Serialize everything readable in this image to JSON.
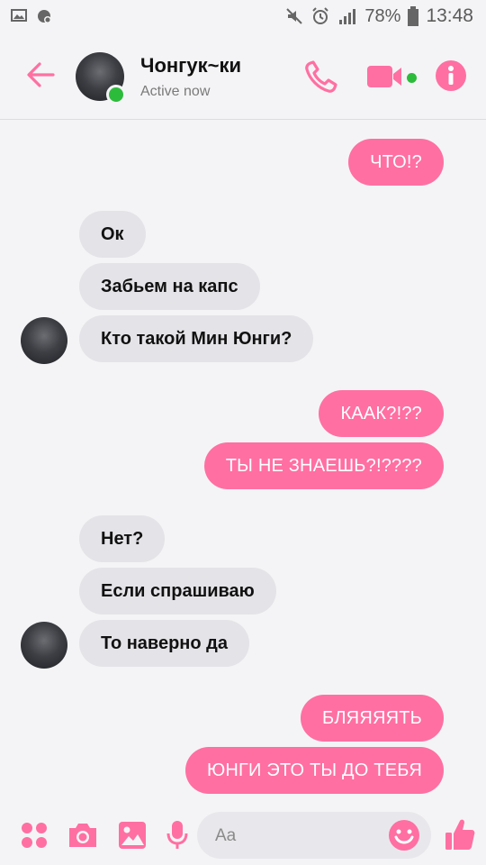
{
  "status_bar": {
    "battery": "78%",
    "time": "13:48"
  },
  "header": {
    "contact_name": "Чонгук~ки",
    "contact_status": "Active now"
  },
  "messages": [
    {
      "side": "out",
      "text": "ЧТО!?"
    },
    {
      "side": "in",
      "text": "Ок"
    },
    {
      "side": "in",
      "text": "Забьем на капс"
    },
    {
      "side": "in",
      "text": "Кто такой Мин Юнги?"
    },
    {
      "side": "out",
      "text": "КААК?!??"
    },
    {
      "side": "out",
      "text": "ТЫ НЕ ЗНАЕШЬ?!????"
    },
    {
      "side": "in",
      "text": "Нет?"
    },
    {
      "side": "in",
      "text": "Если спрашиваю"
    },
    {
      "side": "in",
      "text": "То наверно да"
    },
    {
      "side": "out",
      "text": "БЛЯЯЯЯТЬ"
    },
    {
      "side": "out",
      "text": "ЮНГИ ЭТО ТЫ ДО ТЕБЯ"
    }
  ],
  "composer": {
    "placeholder": "Aa"
  },
  "colors": {
    "accent": "#ff6fa2",
    "online": "#2dbb3b",
    "incoming_bubble": "#e4e4e8"
  },
  "icons": [
    "picture-icon",
    "notification-icon",
    "mute-icon",
    "alarm-icon",
    "signal-icon",
    "battery-icon",
    "back-arrow-icon",
    "phone-icon",
    "video-icon",
    "info-icon",
    "apps-icon",
    "camera-icon",
    "gallery-icon",
    "microphone-icon",
    "emoji-icon",
    "like-icon"
  ]
}
